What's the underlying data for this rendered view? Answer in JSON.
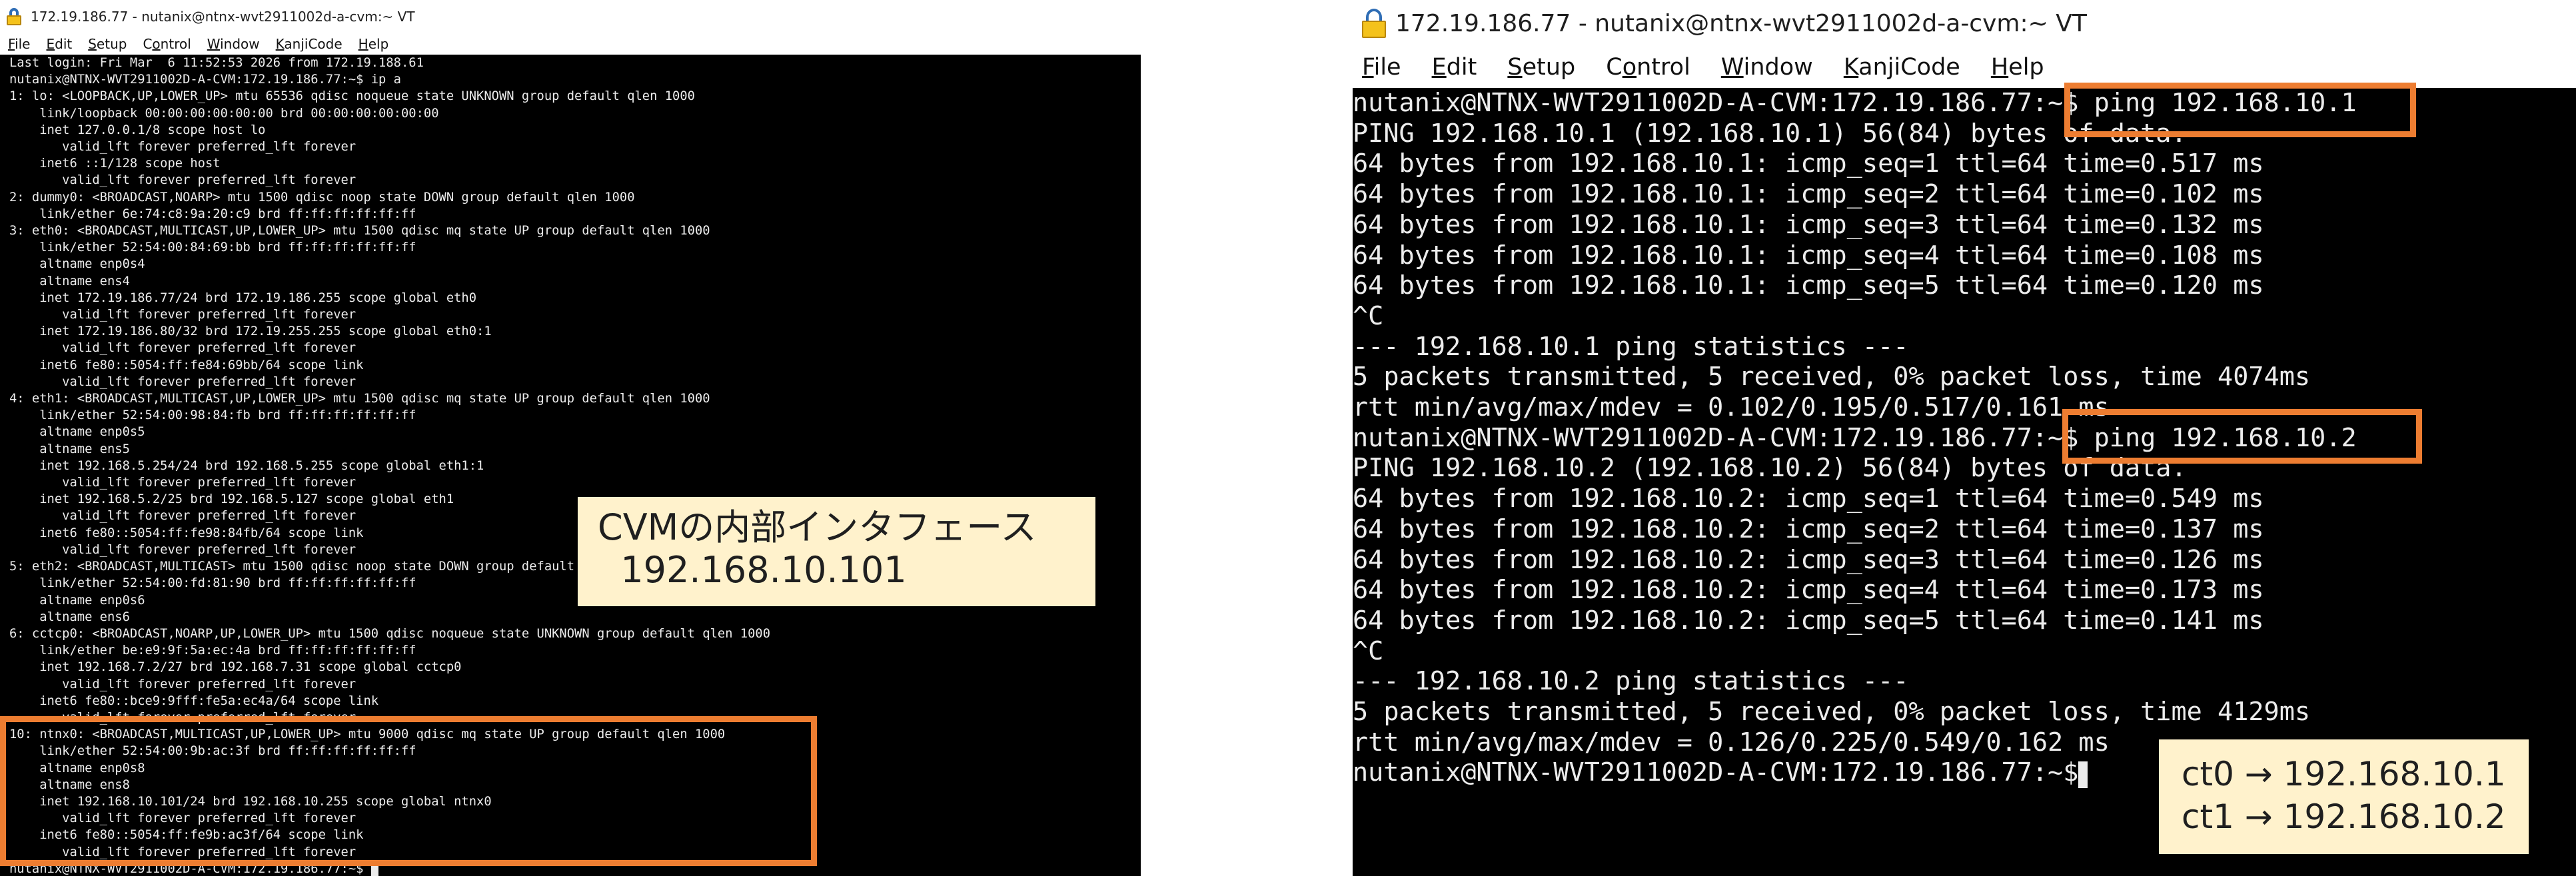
{
  "left_window": {
    "title": "172.19.186.77 - nutanix@ntnx-wvt2911002d-a-cvm:~ VT",
    "menu": [
      {
        "pre": "",
        "key": "F",
        "post": "ile"
      },
      {
        "pre": "",
        "key": "E",
        "post": "dit"
      },
      {
        "pre": "",
        "key": "S",
        "post": "etup"
      },
      {
        "pre": "C",
        "key": "o",
        "post": "ntrol"
      },
      {
        "pre": "",
        "key": "W",
        "post": "indow"
      },
      {
        "pre": "",
        "key": "K",
        "post": "anjiCode"
      },
      {
        "pre": "",
        "key": "H",
        "post": "elp"
      }
    ],
    "lines": [
      "Last login: Fri Mar  6 11:52:53 2026 from 172.19.188.61",
      "nutanix@NTNX-WVT2911002D-A-CVM:172.19.186.77:~$ ip a",
      "1: lo: <LOOPBACK,UP,LOWER_UP> mtu 65536 qdisc noqueue state UNKNOWN group default qlen 1000",
      "    link/loopback 00:00:00:00:00:00 brd 00:00:00:00:00:00",
      "    inet 127.0.0.1/8 scope host lo",
      "       valid_lft forever preferred_lft forever",
      "    inet6 ::1/128 scope host",
      "       valid_lft forever preferred_lft forever",
      "2: dummy0: <BROADCAST,NOARP> mtu 1500 qdisc noop state DOWN group default qlen 1000",
      "    link/ether 6e:74:c8:9a:20:c9 brd ff:ff:ff:ff:ff:ff",
      "3: eth0: <BROADCAST,MULTICAST,UP,LOWER_UP> mtu 1500 qdisc mq state UP group default qlen 1000",
      "    link/ether 52:54:00:84:69:bb brd ff:ff:ff:ff:ff:ff",
      "    altname enp0s4",
      "    altname ens4",
      "    inet 172.19.186.77/24 brd 172.19.186.255 scope global eth0",
      "       valid_lft forever preferred_lft forever",
      "    inet 172.19.186.80/32 brd 172.19.255.255 scope global eth0:1",
      "       valid_lft forever preferred_lft forever",
      "    inet6 fe80::5054:ff:fe84:69bb/64 scope link",
      "       valid_lft forever preferred_lft forever",
      "4: eth1: <BROADCAST,MULTICAST,UP,LOWER_UP> mtu 1500 qdisc mq state UP group default qlen 1000",
      "    link/ether 52:54:00:98:84:fb brd ff:ff:ff:ff:ff:ff",
      "    altname enp0s5",
      "    altname ens5",
      "    inet 192.168.5.254/24 brd 192.168.5.255 scope global eth1:1",
      "       valid_lft forever preferred_lft forever",
      "    inet 192.168.5.2/25 brd 192.168.5.127 scope global eth1",
      "       valid_lft forever preferred_lft forever",
      "    inet6 fe80::5054:ff:fe98:84fb/64 scope link",
      "       valid_lft forever preferred_lft forever",
      "5: eth2: <BROADCAST,MULTICAST> mtu 1500 qdisc noop state DOWN group default qlen 1000",
      "    link/ether 52:54:00:fd:81:90 brd ff:ff:ff:ff:ff:ff",
      "    altname enp0s6",
      "    altname ens6",
      "6: cctcp0: <BROADCAST,NOARP,UP,LOWER_UP> mtu 1500 qdisc noqueue state UNKNOWN group default qlen 1000",
      "    link/ether be:e9:9f:5a:ec:4a brd ff:ff:ff:ff:ff:ff",
      "    inet 192.168.7.2/27 brd 192.168.7.31 scope global cctcp0",
      "       valid_lft forever preferred_lft forever",
      "    inet6 fe80::bce9:9fff:fe5a:ec4a/64 scope link",
      "       valid_lft forever preferred_lft forever",
      "10: ntnx0: <BROADCAST,MULTICAST,UP,LOWER_UP> mtu 9000 qdisc mq state UP group default qlen 1000",
      "    link/ether 52:54:00:9b:ac:3f brd ff:ff:ff:ff:ff:ff",
      "    altname enp0s8",
      "    altname ens8",
      "    inet 192.168.10.101/24 brd 192.168.10.255 scope global ntnx0",
      "       valid_lft forever preferred_lft forever",
      "    inet6 fe80::5054:ff:fe9b:ac3f/64 scope link",
      "       valid_lft forever preferred_lft forever",
      "nutanix@NTNX-WVT2911002D-A-CVM:172.19.186.77:~$ "
    ],
    "callout": [
      "CVMの内部インタフェース",
      "  192.168.10.101"
    ]
  },
  "right_window": {
    "title": "172.19.186.77 - nutanix@ntnx-wvt2911002d-a-cvm:~ VT",
    "menu": [
      {
        "pre": "",
        "key": "F",
        "post": "ile"
      },
      {
        "pre": "",
        "key": "E",
        "post": "dit"
      },
      {
        "pre": "",
        "key": "S",
        "post": "etup"
      },
      {
        "pre": "C",
        "key": "o",
        "post": "ntrol"
      },
      {
        "pre": "",
        "key": "W",
        "post": "indow"
      },
      {
        "pre": "",
        "key": "K",
        "post": "anjiCode"
      },
      {
        "pre": "",
        "key": "H",
        "post": "elp"
      }
    ],
    "lines": [
      "nutanix@NTNX-WVT2911002D-A-CVM:172.19.186.77:~$ ping 192.168.10.1",
      "PING 192.168.10.1 (192.168.10.1) 56(84) bytes of data.",
      "64 bytes from 192.168.10.1: icmp_seq=1 ttl=64 time=0.517 ms",
      "64 bytes from 192.168.10.1: icmp_seq=2 ttl=64 time=0.102 ms",
      "64 bytes from 192.168.10.1: icmp_seq=3 ttl=64 time=0.132 ms",
      "64 bytes from 192.168.10.1: icmp_seq=4 ttl=64 time=0.108 ms",
      "64 bytes from 192.168.10.1: icmp_seq=5 ttl=64 time=0.120 ms",
      "^C",
      "--- 192.168.10.1 ping statistics ---",
      "5 packets transmitted, 5 received, 0% packet loss, time 4074ms",
      "rtt min/avg/max/mdev = 0.102/0.195/0.517/0.161 ms",
      "nutanix@NTNX-WVT2911002D-A-CVM:172.19.186.77:~$ ping 192.168.10.2",
      "PING 192.168.10.2 (192.168.10.2) 56(84) bytes of data.",
      "64 bytes from 192.168.10.2: icmp_seq=1 ttl=64 time=0.549 ms",
      "64 bytes from 192.168.10.2: icmp_seq=2 ttl=64 time=0.137 ms",
      "64 bytes from 192.168.10.2: icmp_seq=3 ttl=64 time=0.126 ms",
      "64 bytes from 192.168.10.2: icmp_seq=4 ttl=64 time=0.173 ms",
      "64 bytes from 192.168.10.2: icmp_seq=5 ttl=64 time=0.141 ms",
      "^C",
      "--- 192.168.10.2 ping statistics ---",
      "5 packets transmitted, 5 received, 0% packet loss, time 4129ms",
      "rtt min/avg/max/mdev = 0.126/0.225/0.549/0.162 ms",
      "nutanix@NTNX-WVT2911002D-A-CVM:172.19.186.77:~$"
    ],
    "callout": [
      "ct0 → 192.168.10.1",
      "ct1 → 192.168.10.2"
    ]
  },
  "colors": {
    "terminal_bg": "#000000",
    "terminal_fg": "#ececec",
    "highlight": "#ed7d31",
    "callout_bg": "#fff2cc"
  }
}
